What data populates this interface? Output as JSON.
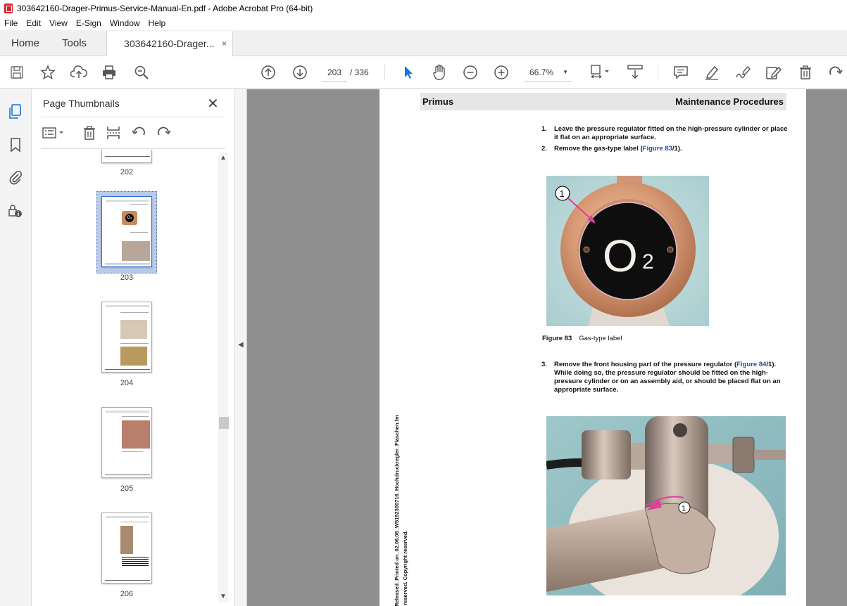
{
  "window": {
    "title": "303642160-Drager-Primus-Service-Manual-En.pdf - Adobe Acrobat Pro (64-bit)"
  },
  "menu": [
    "File",
    "Edit",
    "View",
    "E-Sign",
    "Window",
    "Help"
  ],
  "tabs": {
    "home": "Home",
    "tools": "Tools",
    "document": "303642160-Drager...",
    "close": "×"
  },
  "toolbar": {
    "current_page": "203",
    "page_total": "/ 336",
    "zoom": "66.7%"
  },
  "thumbnail_panel": {
    "title": "Page Thumbnails",
    "pages": [
      "202",
      "203",
      "204",
      "205",
      "206"
    ],
    "selected_page": "203"
  },
  "document": {
    "header_left": "Primus",
    "header_right": "Maintenance Procedures",
    "steps_top": [
      {
        "num": "1.",
        "text": "Leave the pressure regulator fitted on the high-pressure cylinder or place it flat on an appropriate surface."
      },
      {
        "num": "2.",
        "text_before": "Remove the gas-type label (",
        "link": "Figure 83",
        "text_after": "/1)."
      }
    ],
    "figure83": {
      "label": "Figure 83",
      "title": "Gas-type label",
      "callout": "1",
      "label_text": "O",
      "label_sub": "2"
    },
    "step3": {
      "num": "3.",
      "text_before": "Remove the front housing part of the pressure regulator (",
      "link": "Figure 84",
      "text_after": "/1). While doing so, the pressure regulator should be fitted on the high-pressure cylinder or on an assembly aid, or should be placed flat on an appropriate surface."
    },
    "figure84": {
      "callout": "1"
    },
    "side_note_1": "_Released_Printed on_02.06.08_W5152300716_Hochdruckregler_Flaschen.fm",
    "side_note_2": "s reserved. Copyright reserved."
  },
  "colors": {
    "acrobat_red": "#d4262c",
    "accent_blue": "#1473e6",
    "link_blue": "#1f4fa0",
    "callout_pink": "#e0409a"
  }
}
